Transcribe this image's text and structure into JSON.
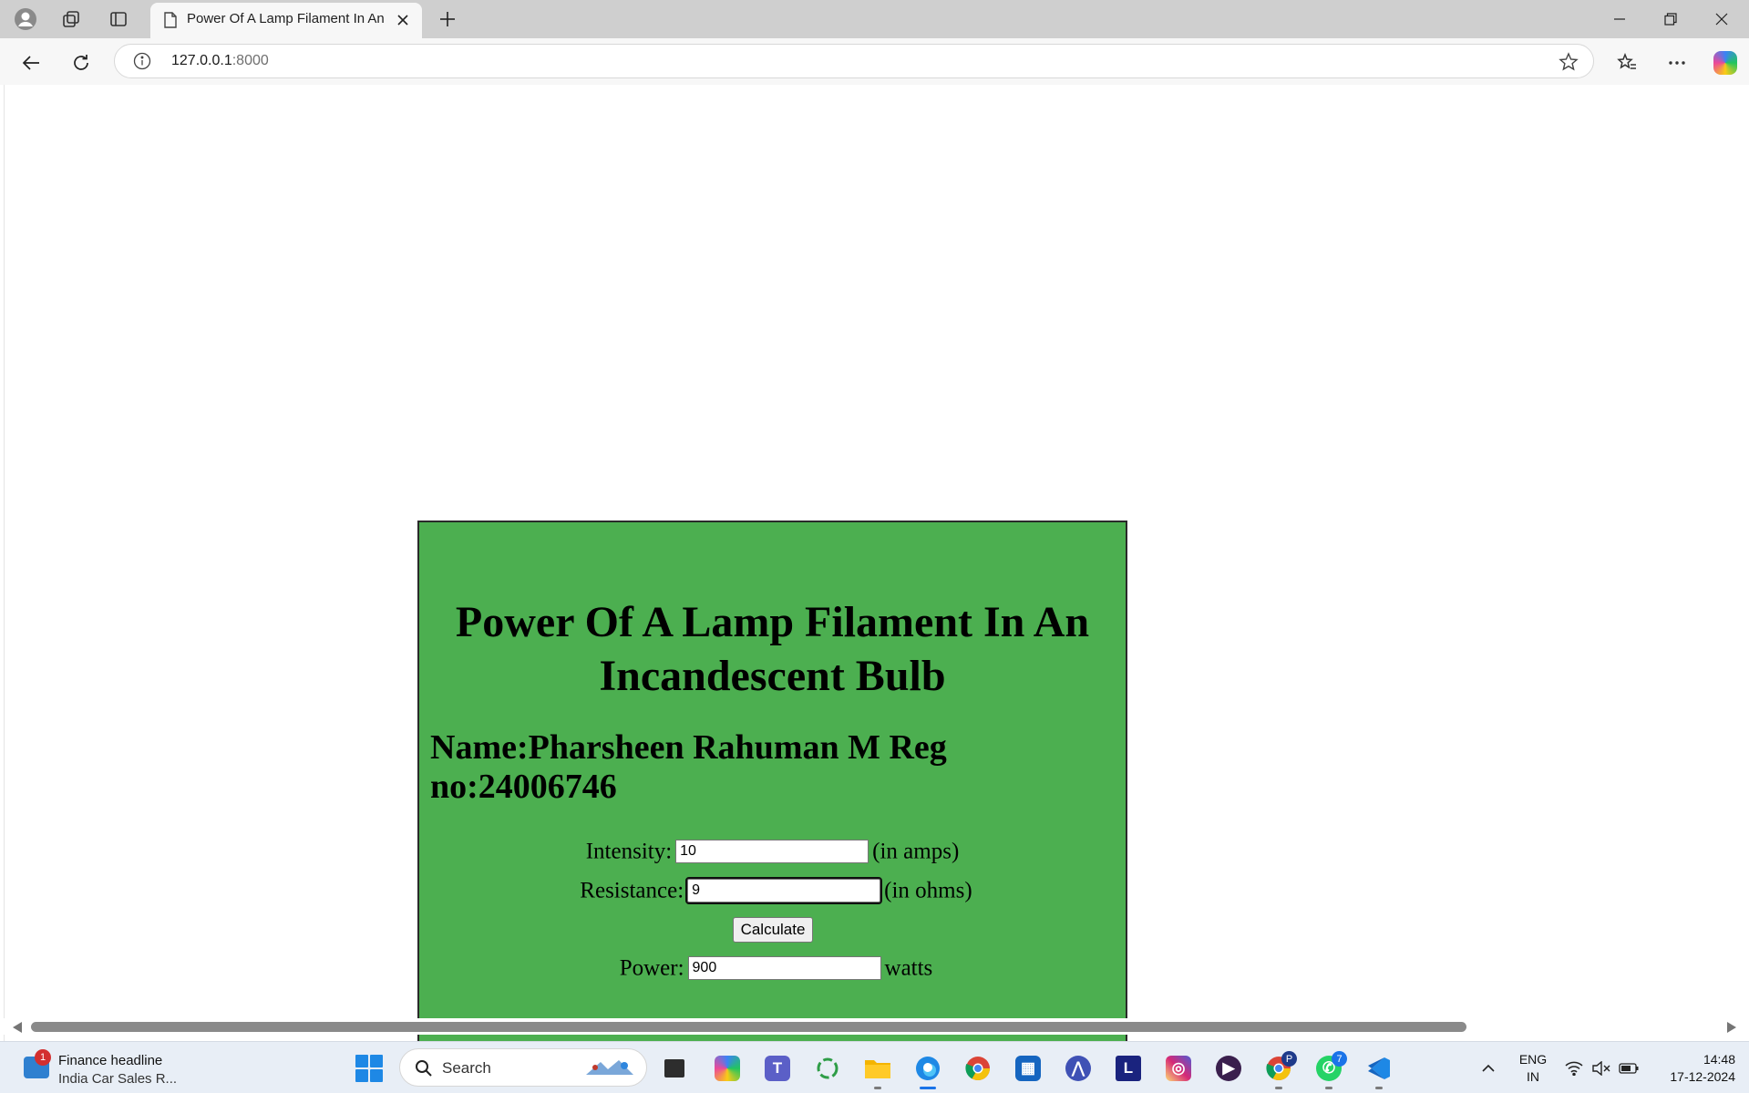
{
  "browser": {
    "tab_title": "Power Of A Lamp Filament In An Incandescent Bulb",
    "url_host": "127.0.0.1",
    "url_port": ":8000"
  },
  "page": {
    "heading": "Power Of A Lamp Filament In An Incandescent Bulb",
    "student": "Name:Pharsheen Rahuman M Reg no:24006746",
    "intensity_label": "Intensity:",
    "intensity_value": "10",
    "intensity_unit": "(in amps)",
    "resistance_label": "Resistance:",
    "resistance_value": "9",
    "resistance_unit": "(in ohms)",
    "calculate_label": "Calculate",
    "power_label": "Power:",
    "power_value": "900",
    "power_unit": "watts",
    "card_color": "#4caf50"
  },
  "taskbar": {
    "widget_badge": "1",
    "widget_title": "Finance headline",
    "widget_subtitle": "India Car Sales R...",
    "search_placeholder": "Search",
    "chrome_profile_badge": "P",
    "whatsapp_badge": "7",
    "lang_top": "ENG",
    "lang_bottom": "IN",
    "time": "14:48",
    "date": "17-12-2024"
  }
}
